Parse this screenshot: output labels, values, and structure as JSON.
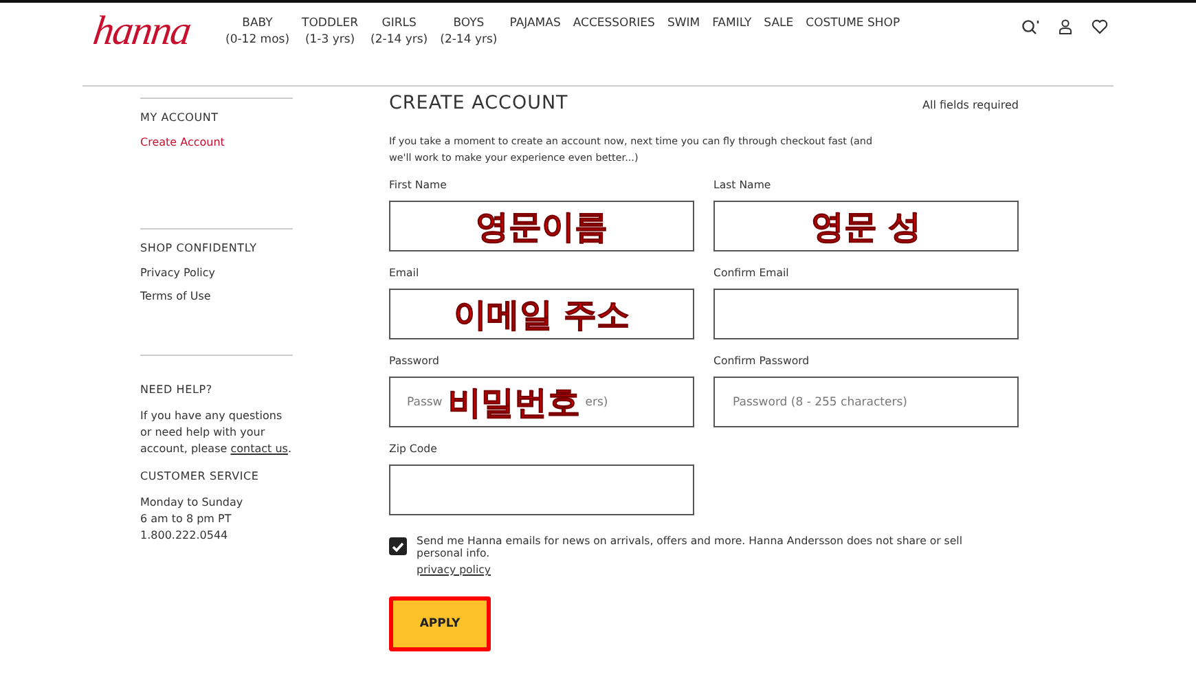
{
  "logo": "hanna",
  "nav": [
    {
      "label": "BABY",
      "sub": "(0-12 mos)"
    },
    {
      "label": "TODDLER",
      "sub": "(1-3 yrs)"
    },
    {
      "label": "GIRLS",
      "sub": "(2-14 yrs)"
    },
    {
      "label": "BOYS",
      "sub": "(2-14 yrs)"
    },
    {
      "label": "PAJAMAS"
    },
    {
      "label": "ACCESSORIES"
    },
    {
      "label": "SWIM"
    },
    {
      "label": "FAMILY"
    },
    {
      "label": "SALE"
    },
    {
      "label": "COSTUME SHOP"
    }
  ],
  "sidebar": [
    {
      "kind": "section",
      "heading": "MY ACCOUNT",
      "links": [
        {
          "label": "Create Account",
          "selected": true
        }
      ]
    },
    {
      "kind": "section",
      "heading": "SHOP CONFIDENTLY",
      "links": [
        {
          "label": "Privacy Policy",
          "selected": false
        },
        {
          "label": "Terms of Use",
          "selected": false
        }
      ]
    },
    {
      "kind": "help",
      "heading": "NEED HELP?",
      "text_before": "If you have any questions or need help with your account, please",
      "link": "contact us",
      "text_after": ".",
      "service_heading": "CUSTOMER SERVICE",
      "service_lines": [
        "Monday to Sunday",
        "6 am to 8 pm PT",
        "1.800.222.0544"
      ]
    }
  ],
  "form": {
    "title": "CREATE ACCOUNT",
    "required_note": "All fields required",
    "intro": "If you take a moment to create an account now, next time you can fly through checkout fast (and we'll work to make your experience even better...)",
    "fields": [
      {
        "label": "First Name",
        "annotation": "영문이름"
      },
      {
        "label": "Last Name",
        "annotation": "영문 성"
      },
      {
        "label": "Email",
        "annotation": "이메일 주소"
      },
      {
        "label": "Confirm Email"
      },
      {
        "label": "Password",
        "placeholder": "Passw",
        "placeholder_end": "ers)",
        "annotation": "비밀번호"
      },
      {
        "label": "Confirm Password",
        "placeholder": "Password (8 - 255 characters)"
      },
      {
        "label": "Zip Code"
      }
    ],
    "newsletter": {
      "checked": true,
      "text": "Send me Hanna emails for news on arrivals, offers and more. Hanna Andersson does not share or sell personal info.",
      "link": "privacy policy"
    },
    "submit": "APPLY"
  }
}
